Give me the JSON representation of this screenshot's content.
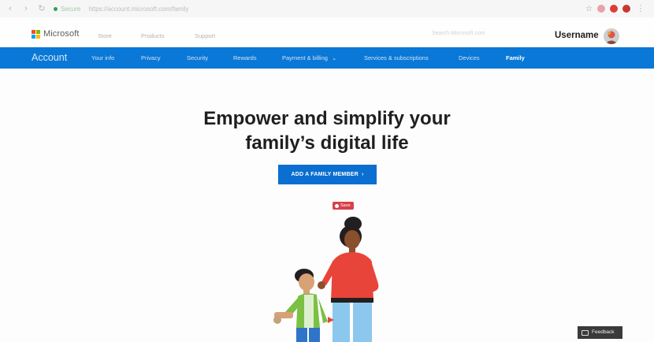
{
  "browser": {
    "secure_label": "Secure",
    "url": "https://account.microsoft.com/family"
  },
  "header": {
    "logo_text": "Microsoft",
    "links": [
      "Store",
      "Products",
      "Support"
    ],
    "search_placeholder": "Search Microsoft.com",
    "username": "Username"
  },
  "account_nav": {
    "title": "Account",
    "items": [
      "Your info",
      "Privacy",
      "Security",
      "Rewards",
      "Payment & billing",
      "Services & subscriptions",
      "Devices",
      "Family"
    ],
    "active_item": "Family",
    "accent_color": "#0a78d6"
  },
  "hero": {
    "title_line1": "Empower and simplify your",
    "title_line2": "family’s digital life",
    "cta_label": "ADD A FAMILY MEMBER",
    "save_label": "Save"
  },
  "feedback": {
    "label": "Feedback"
  },
  "icons": {
    "logo": "microsoft-logo-icon",
    "avatar": "user-avatar-icon",
    "chevron": "chevron-right-icon",
    "dropdown": "chevron-down-icon",
    "feedback": "feedback-icon"
  }
}
